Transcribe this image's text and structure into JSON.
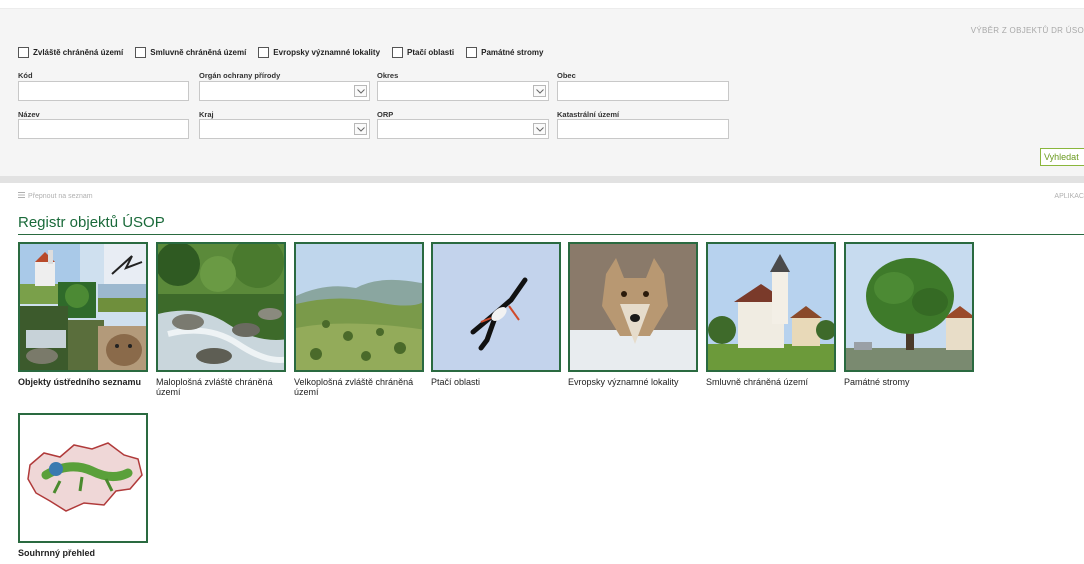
{
  "filter_panel": {
    "title": "VÝBĚR Z OBJEKTŮ DR ÚSO",
    "checkboxes": [
      {
        "label": "Zvláště chráněná území"
      },
      {
        "label": "Smluvně chráněná území"
      },
      {
        "label": "Evropsky významné lokality"
      },
      {
        "label": "Ptačí oblasti"
      },
      {
        "label": "Památné stromy"
      }
    ],
    "fields": {
      "kod": {
        "label": "Kód",
        "value": ""
      },
      "organ": {
        "label": "Orgán ochrany přírody",
        "value": ""
      },
      "okres": {
        "label": "Okres",
        "value": ""
      },
      "obec": {
        "label": "Obec",
        "value": ""
      },
      "nazev": {
        "label": "Název",
        "value": ""
      },
      "kraj": {
        "label": "Kraj",
        "value": ""
      },
      "orp": {
        "label": "ORP",
        "value": ""
      },
      "katastralni": {
        "label": "Katastrální území",
        "value": ""
      }
    },
    "search_button": "Vyhledat"
  },
  "toolbar": {
    "switch_label": "Přepnout na seznam",
    "app_label": "APLIKAC"
  },
  "registry": {
    "title": "Registr objektů ÚSOP",
    "tiles": [
      {
        "label": "Objekty ústředního seznamu",
        "icon": "collage-image"
      },
      {
        "label": "Maloplošná zvláště chráněná území",
        "icon": "river-image"
      },
      {
        "label": "Velkoplošná zvláště chráněná území",
        "icon": "landscape-image"
      },
      {
        "label": "Ptačí oblasti",
        "icon": "stork-image"
      },
      {
        "label": "Evropsky významné lokality",
        "icon": "wolf-image"
      },
      {
        "label": "Smluvně chráněná území",
        "icon": "church-image"
      },
      {
        "label": "Památné stromy",
        "icon": "tree-image"
      },
      {
        "label": "Souhrnný přehled",
        "icon": "map-lizard-image"
      }
    ]
  },
  "colors": {
    "accent_green": "#2a6a40",
    "button_green": "#8ab63c",
    "panel_bg": "#f5f5f5"
  }
}
